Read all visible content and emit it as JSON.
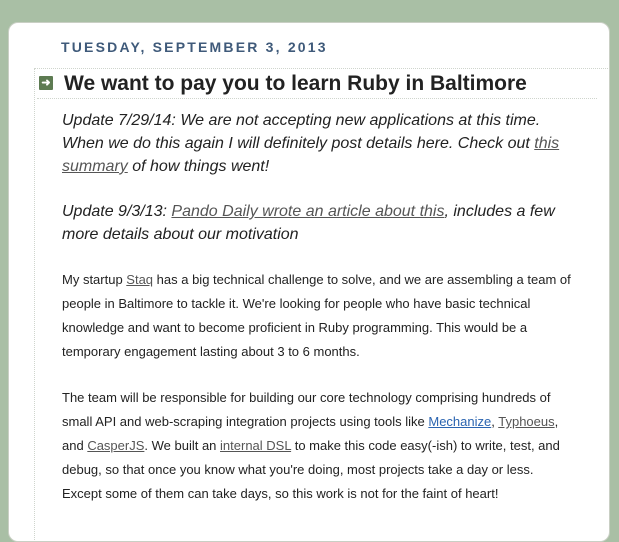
{
  "post": {
    "date": "TUESDAY, SEPTEMBER 3, 2013",
    "title": "We want to pay you to learn Ruby in Baltimore",
    "update_1": {
      "prefix": "Update 7/29/14: We are not accepting new applications at this time. When we do this again I will definitely post details here. Check out ",
      "link_text": "this summary",
      "suffix": " of how things went!"
    },
    "update_2": {
      "prefix": "Update 9/3/13: ",
      "link_text": "Pando Daily wrote an article about this",
      "suffix": ", includes a few more details about our motivation"
    },
    "paragraph_1": {
      "text_1": "My startup ",
      "link_staq": "Staq",
      "text_2": " has a big technical challenge to solve, and we are assembling a team of people in Baltimore to tackle it. We're looking for people who have basic technical knowledge and want to become proficient in Ruby programming. This would be a temporary engagement lasting about 3 to 6 months."
    },
    "paragraph_2": {
      "text_1": "The team will be responsible for building our core technology comprising hundreds of small API and web-scraping integration projects using tools like ",
      "link_mechanize": "Mechanize",
      "text_2": ", ",
      "link_typhoeus": "Typhoeus",
      "text_3": ", and ",
      "link_casperjs": "CasperJS",
      "text_4": ". We built an ",
      "link_dsl": "internal DSL",
      "text_5": " to make this code easy(-ish) to write, test, and debug, so that once you know what you're doing, most projects take a day or less. Except some of them can take days, so this work is not for the faint of heart!"
    }
  }
}
